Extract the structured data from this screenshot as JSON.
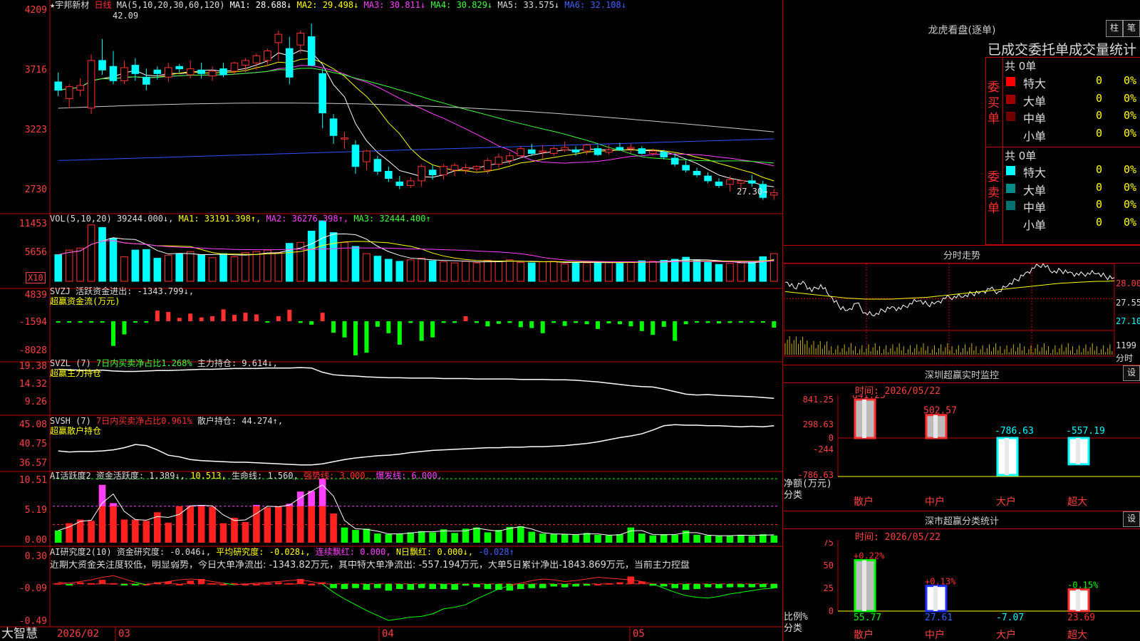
{
  "header": {
    "stock": "★宇邦新材",
    "period": "日线",
    "ma_params": "MA(5,10,20,30,60,120)",
    "ma_items": [
      {
        "label": "MA1: 28.688↓",
        "color": "#ffffff"
      },
      {
        "label": "MA2: 29.498↓",
        "color": "#ffff00"
      },
      {
        "label": "MA3: 30.811↓",
        "color": "#ff40ff"
      },
      {
        "label": "MA4: 30.829↓",
        "color": "#40ff40"
      },
      {
        "label": "MA5: 33.575↓",
        "color": "#dddddd"
      },
      {
        "label": "MA6: 32.108↓",
        "color": "#4060ff"
      }
    ],
    "high_label": "42.09",
    "low_label": "27.30"
  },
  "price_axis": [
    "4209",
    "3716",
    "3223",
    "2730"
  ],
  "volume": {
    "header": "VOL(5,10,20)",
    "value": "39244.000↓,",
    "ma1": "MA1: 33191.398↑,",
    "ma2": "MA2: 36276.398↑,",
    "ma3": "MA3: 32444.400↑",
    "axis": [
      "11453",
      "5656"
    ],
    "unit": "X10"
  },
  "svzj": {
    "header": "SVZJ  活跃资金进出: -1343.799↓,",
    "sub": "超赢资金流(万元)",
    "axis": [
      "4839",
      "-1594",
      "-8028"
    ]
  },
  "svzl": {
    "header_a": "SVZL  (7)",
    "header_b": "7日内买卖净占比1.268%",
    "header_c": "主力持仓: 9.614↓,",
    "sub": "超赢主力持仓",
    "axis": [
      "19.38",
      "14.32",
      "9.26"
    ]
  },
  "svsh": {
    "header_a": "SVSH  (7)",
    "header_b": "7日内买卖净占比0.961%",
    "header_c": "散户持仓: 44.274↑,",
    "sub": "超赢散户持仓",
    "axis": [
      "45.08",
      "40.75",
      "36.57"
    ]
  },
  "ai_active": {
    "header_a": "AI活跃度2",
    "header_b": "资金活跃度: 1.389↓,",
    "header_c": "10.513,",
    "header_d": "生命线: 1.560,",
    "header_e": "强势线: 3.000,",
    "header_f": "爆发线: 6.000,",
    "axis": [
      "10.51",
      "5.19",
      "0.00"
    ]
  },
  "ai_research": {
    "header_a": "AI研究度2(10)",
    "header_b": "资金研究度: -0.046↓,",
    "header_c": "平均研究度: -0.028↓,",
    "header_d": "连续飘红: 0.000,",
    "header_e": "N日飘红: 0.000↓,",
    "header_f": "-0.028↑",
    "comment": "近期大资金关注度较低，明显弱势，今日大单净流出: -1343.82万元，其中特大单净流出: -557.194万元，大单5日累计净出-1843.869万元，当前主力控盘",
    "axis": [
      "0.30",
      "-0.09",
      "-0.49"
    ]
  },
  "footer": {
    "brand": "大智慧",
    "dates": [
      "2026/02",
      "03",
      "04",
      "05"
    ]
  },
  "longhu": {
    "title": "龙虎看盘(逐单)",
    "btn1": "柱",
    "btn2": "笔",
    "subtitle": "已成交委托单成交量统计",
    "buy_label": "委买单",
    "sell_label": "委卖单",
    "buy_total": "共 0单",
    "sell_total": "共 0单",
    "buy_rows": [
      {
        "name": "特大",
        "count": "0",
        "pct": "0%",
        "color": "#ff0000"
      },
      {
        "name": "大单",
        "count": "0",
        "pct": "0%",
        "color": "#a00000"
      },
      {
        "name": "中单",
        "count": "0",
        "pct": "0%",
        "color": "#700000"
      },
      {
        "name": "小单",
        "count": "0",
        "pct": "0%",
        "color": "#000000"
      }
    ],
    "sell_rows": [
      {
        "name": "特大",
        "count": "0",
        "pct": "0%",
        "color": "#00ffff"
      },
      {
        "name": "大单",
        "count": "0",
        "pct": "0%",
        "color": "#008a8a"
      },
      {
        "name": "中单",
        "count": "0",
        "pct": "0%",
        "color": "#007070"
      },
      {
        "name": "小单",
        "count": "0",
        "pct": "0%",
        "color": "#000000"
      }
    ]
  },
  "intraday": {
    "title": "分时走势",
    "axis": [
      "28.00",
      "27.55",
      "27.10"
    ],
    "vol_label": "1199",
    "unit_label": "分时"
  },
  "sz_monitor": {
    "title": "深圳超赢实时监控",
    "btn": "设",
    "time": "时间: 2026/05/22",
    "axis": [
      "841.25",
      "298.63",
      "0",
      "-244",
      "-786.63"
    ],
    "ylabel": "净额(万元)",
    "xlabel": "分类",
    "bars": [
      {
        "cat": "散户",
        "value": 841.25,
        "label": "841.25",
        "fill": "#bbbbbb",
        "edge": "#ff3030"
      },
      {
        "cat": "中户",
        "value": 502.57,
        "label": "502.57",
        "fill": "#bbbbbb",
        "edge": "#ff3030"
      },
      {
        "cat": "大户",
        "value": -786.63,
        "label": "-786.63",
        "fill": "#ffffff",
        "edge": "#00ffff"
      },
      {
        "cat": "超大",
        "value": -557.19,
        "label": "-557.19",
        "fill": "#ffffff",
        "edge": "#00ffff"
      }
    ]
  },
  "sz_class": {
    "title": "深市超赢分类统计",
    "btn": "设",
    "time": "时间: 2026/05/22",
    "axis": [
      "75",
      "50",
      "25",
      "0"
    ],
    "ylabel": "比例%",
    "xlabel": "分类",
    "bars": [
      {
        "cat": "散户",
        "value": 55.77,
        "label": "55.77",
        "top": "+0.22%",
        "fill": "#bbbbbb",
        "edge": "#00ff00",
        "topcolor": "#ff3030",
        "botcolor": "#00ff00"
      },
      {
        "cat": "中户",
        "value": 27.61,
        "label": "27.61",
        "top": "+0.13%",
        "fill": "#ffffff",
        "edge": "#2030ff",
        "topcolor": "#ff3030",
        "botcolor": "#3060ff"
      },
      {
        "cat": "大户",
        "value": -7.07,
        "label": "-7.07",
        "top": "",
        "fill": "#ffffff",
        "edge": "#00ffff",
        "topcolor": "#ff3030",
        "botcolor": "#00ffff"
      },
      {
        "cat": "超大",
        "value": 23.69,
        "label": "23.69",
        "top": "-0.15%",
        "fill": "#ffffff",
        "edge": "#ff3030",
        "topcolor": "#00ff00",
        "botcolor": "#ff3030"
      }
    ]
  },
  "chart_data": {
    "type": "candlestick",
    "price": {
      "ylim": [
        26.5,
        43.0
      ],
      "ohlc": [
        [
          37.2,
          38.0,
          36.0,
          36.5
        ],
        [
          35.8,
          37.0,
          35.0,
          36.8
        ],
        [
          36.5,
          37.5,
          36.0,
          36.9
        ],
        [
          35.0,
          39.5,
          34.5,
          39.0
        ],
        [
          39.0,
          40.8,
          37.8,
          38.2
        ],
        [
          38.5,
          39.8,
          37.0,
          37.3
        ],
        [
          37.3,
          39.0,
          37.0,
          38.4
        ],
        [
          38.6,
          39.2,
          37.3,
          37.9
        ],
        [
          37.6,
          38.3,
          36.5,
          37.0
        ],
        [
          38.2,
          38.5,
          37.4,
          37.9
        ],
        [
          37.6,
          38.8,
          37.2,
          38.4
        ],
        [
          38.5,
          38.7,
          38.0,
          38.3
        ],
        [
          37.8,
          39.0,
          37.5,
          38.3
        ],
        [
          38.2,
          38.8,
          37.5,
          37.9
        ],
        [
          37.7,
          38.5,
          37.3,
          38.1
        ],
        [
          38.3,
          38.8,
          37.6,
          37.8
        ],
        [
          38.1,
          38.9,
          37.8,
          38.8
        ],
        [
          38.6,
          39.2,
          38.0,
          39.0
        ],
        [
          38.8,
          39.6,
          38.2,
          39.4
        ],
        [
          39.0,
          40.0,
          38.5,
          39.8
        ],
        [
          40.5,
          41.5,
          39.0,
          41.2
        ],
        [
          40.0,
          41.0,
          37.0,
          37.6
        ],
        [
          40.3,
          41.5,
          39.6,
          41.3
        ],
        [
          41.0,
          42.09,
          38.5,
          38.6
        ],
        [
          37.9,
          38.3,
          33.3,
          34.6
        ],
        [
          34.1,
          34.5,
          32.0,
          32.7
        ],
        [
          32.4,
          33.0,
          31.6,
          32.5
        ],
        [
          31.9,
          32.3,
          29.5,
          30.1
        ],
        [
          30.5,
          31.5,
          29.8,
          31.4
        ],
        [
          30.7,
          31.0,
          29.4,
          29.7
        ],
        [
          29.7,
          30.1,
          28.8,
          29.1
        ],
        [
          28.8,
          29.3,
          28.2,
          28.5
        ],
        [
          28.5,
          29.2,
          28.3,
          28.9
        ],
        [
          28.9,
          30.3,
          28.4,
          30.1
        ],
        [
          29.8,
          30.2,
          29.0,
          29.4
        ],
        [
          29.4,
          30.3,
          29.0,
          30.1
        ],
        [
          29.8,
          30.4,
          29.3,
          30.2
        ],
        [
          29.8,
          30.3,
          29.5,
          30.0
        ],
        [
          29.9,
          30.2,
          29.6,
          30.1
        ],
        [
          29.8,
          30.8,
          29.5,
          30.6
        ],
        [
          30.3,
          31.2,
          30.0,
          30.9
        ],
        [
          30.6,
          31.3,
          30.3,
          31.0
        ],
        [
          31.0,
          31.8,
          30.8,
          31.6
        ],
        [
          31.5,
          32.0,
          31.0,
          31.2
        ],
        [
          31.3,
          31.9,
          30.8,
          31.4
        ],
        [
          31.2,
          31.8,
          31.0,
          31.6
        ],
        [
          31.5,
          32.2,
          31.3,
          31.7
        ],
        [
          31.5,
          31.8,
          31.0,
          31.3
        ],
        [
          31.4,
          32.0,
          31.1,
          31.9
        ],
        [
          31.6,
          31.9,
          31.0,
          31.1
        ],
        [
          31.3,
          31.9,
          31.1,
          31.5
        ],
        [
          31.7,
          32.1,
          31.4,
          31.5
        ],
        [
          31.6,
          32.0,
          31.2,
          31.7
        ],
        [
          31.6,
          31.8,
          31.1,
          31.2
        ],
        [
          31.2,
          31.6,
          31.0,
          31.4
        ],
        [
          31.3,
          31.5,
          30.7,
          30.9
        ],
        [
          30.8,
          31.2,
          30.1,
          30.3
        ],
        [
          30.2,
          30.6,
          29.6,
          29.8
        ],
        [
          29.7,
          30.0,
          29.2,
          29.4
        ],
        [
          29.3,
          29.6,
          28.7,
          28.9
        ],
        [
          28.8,
          29.1,
          28.3,
          28.5
        ],
        [
          28.6,
          29.3,
          28.0,
          29.0
        ],
        [
          28.7,
          29.0,
          28.1,
          28.9
        ],
        [
          28.9,
          29.4,
          28.4,
          28.7
        ],
        [
          28.6,
          28.9,
          27.3,
          27.5
        ],
        [
          27.7,
          28.2,
          27.3,
          27.9
        ]
      ]
    },
    "volume": {
      "ylim": [
        0,
        12500
      ],
      "values": [
        5200,
        6100,
        6500,
        11000,
        10500,
        8400,
        4800,
        6100,
        6200,
        4500,
        5100,
        5400,
        5800,
        5200,
        4600,
        5400,
        4800,
        5600,
        5800,
        6100,
        5600,
        7400,
        7600,
        9800,
        11800,
        9500,
        7600,
        6800,
        5400,
        4900,
        4300,
        3900,
        4200,
        4500,
        4000,
        3800,
        3600,
        3900,
        3600,
        4100,
        3900,
        4200,
        3700,
        3600,
        3800,
        3900,
        3400,
        3700,
        3600,
        3800,
        3700,
        3500,
        3800,
        4000,
        3900,
        4100,
        4300,
        4700,
        4100,
        3700,
        3300,
        3500,
        3600,
        3900,
        4800,
        5400
      ]
    },
    "fund_flow": {
      "ylim": [
        -8200,
        5200
      ],
      "values": [
        -300,
        -200,
        -250,
        -150,
        -200,
        -5800,
        -3100,
        -300,
        -250,
        2500,
        2200,
        800,
        1800,
        900,
        1200,
        2800,
        1500,
        2000,
        1600,
        -200,
        1200,
        2700,
        -400,
        -800,
        2000,
        -2700,
        -3800,
        -8000,
        -7400,
        -1300,
        -2800,
        -5500,
        -400,
        -4600,
        -3800,
        -400,
        -400,
        1200,
        -400,
        -1200,
        -600,
        -400,
        -1400,
        -1600,
        -2800,
        -400,
        -1100,
        -400,
        -700,
        -1800,
        -500,
        -700,
        -1200,
        -2300,
        -3200,
        -1300,
        -4600,
        -700,
        -300,
        -400,
        -500,
        -400,
        -200,
        -300,
        -300,
        -1500
      ]
    },
    "main_holding": {
      "ylim": [
        8.5,
        20.0
      ],
      "values": [
        18.9,
        18.8,
        18.7,
        18.6,
        18.7,
        18.5,
        18.4,
        18.4,
        18.5,
        18.6,
        18.6,
        18.7,
        18.8,
        18.9,
        18.9,
        19.0,
        19.1,
        19.1,
        19.1,
        19.2,
        19.2,
        19.2,
        19.3,
        19.2,
        18.2,
        17.6,
        17.4,
        17.3,
        17.1,
        17.0,
        16.9,
        16.9,
        16.8,
        16.8,
        16.8,
        16.7,
        16.7,
        16.7,
        16.6,
        16.6,
        16.6,
        16.6,
        16.5,
        16.5,
        16.5,
        16.4,
        16.4,
        16.3,
        16.1,
        15.9,
        15.6,
        15.3,
        15.0,
        14.8,
        14.7,
        14.2,
        13.6,
        13.0,
        12.8,
        12.9,
        12.7,
        12.6,
        12.5,
        12.4,
        12.2,
        12.0
      ]
    },
    "retail_holding": {
      "ylim": [
        36.3,
        45.6
      ],
      "values": [
        39.6,
        39.4,
        39.5,
        39.5,
        39.6,
        39.8,
        40.2,
        40.8,
        40.6,
        39.8,
        38.8,
        38.5,
        38.0,
        37.8,
        37.7,
        37.6,
        37.5,
        37.5,
        37.4,
        37.3,
        37.2,
        37.1,
        37.0,
        37.0,
        37.2,
        37.6,
        38.0,
        38.3,
        38.5,
        38.7,
        38.8,
        39.0,
        39.3,
        39.5,
        39.7,
        39.8,
        39.9,
        40.0,
        40.1,
        40.2,
        40.2,
        40.3,
        40.3,
        40.4,
        40.4,
        40.5,
        40.6,
        40.8,
        41.0,
        41.3,
        41.7,
        42.1,
        42.4,
        42.8,
        43.5,
        44.3,
        44.5,
        44.4,
        44.4,
        44.3,
        44.3,
        44.2,
        44.1,
        44.2,
        44.1,
        44.3
      ]
    },
    "activity": {
      "ylim": [
        0,
        11.0
      ],
      "values": [
        2.0,
        3.2,
        3.8,
        3.6,
        9.5,
        6.5,
        3.8,
        3.8,
        3.6,
        5.0,
        3.3,
        6.0,
        6.1,
        6.2,
        5.9,
        3.2,
        4.1,
        3.4,
        6.2,
        5.8,
        6.0,
        6.4,
        8.4,
        8.5,
        10.5,
        4.8,
        2.5,
        2.1,
        2.3,
        1.5,
        1.4,
        1.5,
        1.7,
        1.9,
        1.7,
        2.2,
        1.6,
        2.3,
        2.5,
        1.7,
        2.1,
        2.6,
        2.7,
        1.8,
        1.5,
        1.4,
        1.4,
        1.3,
        1.6,
        1.3,
        1.2,
        1.4,
        2.5,
        1.5,
        1.2,
        1.4,
        1.3,
        2.0,
        1.3,
        1.2,
        1.1,
        1.2,
        1.3,
        1.1,
        1.4,
        1.2
      ],
      "strong_line": 3.0,
      "burst_line": 6.0
    },
    "research": {
      "ylim": [
        -0.49,
        0.3
      ],
      "values": [
        0.01,
        -0.01,
        0.02,
        0.01,
        0.05,
        0.01,
        -0.01,
        -0.01,
        0.0,
        0.02,
        0.03,
        0.0,
        0.04,
        0.06,
        0.01,
        0.0,
        0.01,
        0.0,
        0.0,
        0.01,
        0.02,
        0.01,
        0.06,
        0.0,
        0.02,
        -0.05,
        -0.06,
        -0.05,
        -0.07,
        -0.05,
        -0.08,
        -0.06,
        -0.07,
        -0.05,
        -0.06,
        -0.06,
        -0.07,
        -0.02,
        -0.04,
        -0.06,
        -0.07,
        -0.08,
        -0.06,
        -0.05,
        -0.05,
        -0.03,
        -0.04,
        -0.03,
        -0.02,
        0.0,
        0.01,
        0.02,
        0.09,
        0.03,
        -0.02,
        -0.03,
        -0.05,
        -0.07,
        -0.06,
        -0.04,
        -0.05,
        -0.04,
        -0.04,
        -0.04,
        -0.04,
        -0.05
      ],
      "line": [
        0.02,
        0.01,
        0.03,
        0.05,
        0.08,
        0.1,
        0.06,
        0.02,
        -0.01,
        0.01,
        0.03,
        0.05,
        0.06,
        0.05,
        0.03,
        0.01,
        -0.01,
        0.0,
        0.01,
        0.02,
        0.03,
        0.04,
        0.05,
        0.03,
        0.0,
        -0.1,
        -0.18,
        -0.25,
        -0.32,
        -0.38,
        -0.44,
        -0.42,
        -0.4,
        -0.39,
        -0.36,
        -0.3,
        -0.28,
        -0.25,
        -0.18,
        -0.12,
        -0.06,
        -0.02,
        0.01,
        0.04,
        0.06,
        0.05,
        0.03,
        0.04,
        0.06,
        0.08,
        0.07,
        0.06,
        0.05,
        0.03,
        0.0,
        -0.05,
        -0.1,
        -0.14,
        -0.16,
        -0.17,
        -0.15,
        -0.12,
        -0.1,
        -0.08,
        -0.06,
        -0.05
      ]
    },
    "intraday": {
      "ylim": [
        26.9,
        28.3
      ],
      "price": [
        27.9,
        27.78,
        27.92,
        27.7,
        27.85,
        27.6,
        27.4,
        27.3,
        27.45,
        27.25,
        27.18,
        27.3,
        27.38,
        27.32,
        27.45,
        27.5,
        27.42,
        27.48,
        27.55,
        27.6,
        27.58,
        27.66,
        27.7,
        27.75,
        27.7,
        27.82,
        27.95,
        28.1,
        28.2,
        28.3,
        28.1,
        28.15,
        28.12,
        28.05,
        28.1,
        28.08,
        28.02,
        28.0
      ],
      "avg": [
        27.7,
        27.68,
        27.66,
        27.64,
        27.62,
        27.6,
        27.58,
        27.56,
        27.55,
        27.54,
        27.54,
        27.54,
        27.54,
        27.55,
        27.56,
        27.57,
        27.58,
        27.6,
        27.62,
        27.64,
        27.66,
        27.68,
        27.7,
        27.72,
        27.74,
        27.76,
        27.78,
        27.8,
        27.82,
        27.84,
        27.86,
        27.88,
        27.89,
        27.9,
        27.91,
        27.92,
        27.92,
        27.93
      ]
    }
  }
}
